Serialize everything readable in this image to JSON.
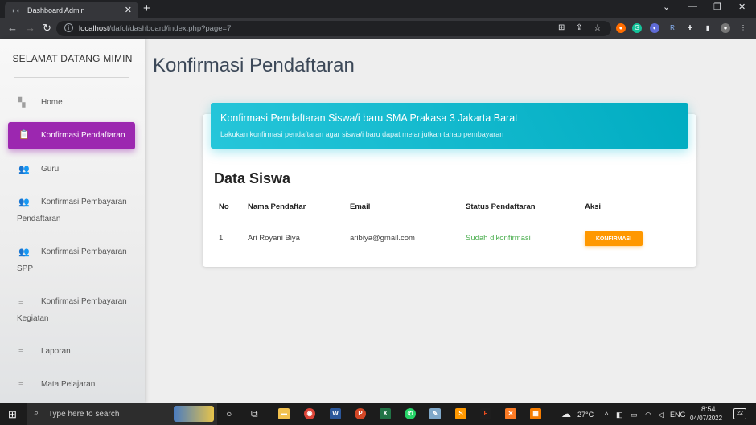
{
  "browser": {
    "tab_title": "Dashboard Admin",
    "tab_close": "✕",
    "new_tab": "+",
    "url_host": "localhost",
    "url_path": "/dafol/dashboard/index.php?page=7"
  },
  "sidebar": {
    "brand": "SELAMAT DATANG MIMIN",
    "items": [
      {
        "label": "Home",
        "icon": "dashboard-icon"
      },
      {
        "label": "Konfirmasi Pendaftaran",
        "icon": "clipboard-icon"
      },
      {
        "label": "Guru",
        "icon": "people-icon"
      },
      {
        "label": "Konfirmasi Pembayaran",
        "label2": "Pendaftaran",
        "icon": "people-icon"
      },
      {
        "label": "Konfirmasi Pembayaran",
        "label2": "SPP",
        "icon": "people-icon"
      },
      {
        "label": "Konfirmasi Pembayaran",
        "label2": "Kegiatan",
        "icon": "list-icon"
      },
      {
        "label": "Laporan",
        "icon": "list-icon"
      },
      {
        "label": "Mata Pelajaran",
        "icon": "list-icon"
      }
    ]
  },
  "main": {
    "page_title": "Konfirmasi Pendaftaran",
    "card": {
      "title": "Konfirmasi Pendaftaran Siswa/i baru SMA Prakasa 3 Jakarta Barat",
      "subtitle": "Lakukan konfirmasi pendaftaran agar siswa/i baru dapat melanjutkan tahap pembayaran"
    },
    "section_title": "Data Siswa",
    "table": {
      "headers": [
        "No",
        "Nama Pendaftar",
        "Email",
        "Status Pendaftaran",
        "Aksi"
      ],
      "rows": [
        {
          "no": "1",
          "nama": "Ari Royani Biya",
          "email": "aribiya@gmail.com",
          "status": "Sudah dikonfirmasi",
          "aksi": "KONFIRMASI"
        }
      ]
    }
  },
  "taskbar": {
    "search_placeholder": "Type here to search",
    "temperature": "27°C",
    "language": "ENG",
    "time": "8:54",
    "date": "04/07/2022",
    "notifications": "22"
  },
  "colors": {
    "accent_purple": "#9c27b0",
    "header_cyan": "#00bcd4",
    "button_orange": "#ff9800",
    "status_green": "#4caf50"
  }
}
